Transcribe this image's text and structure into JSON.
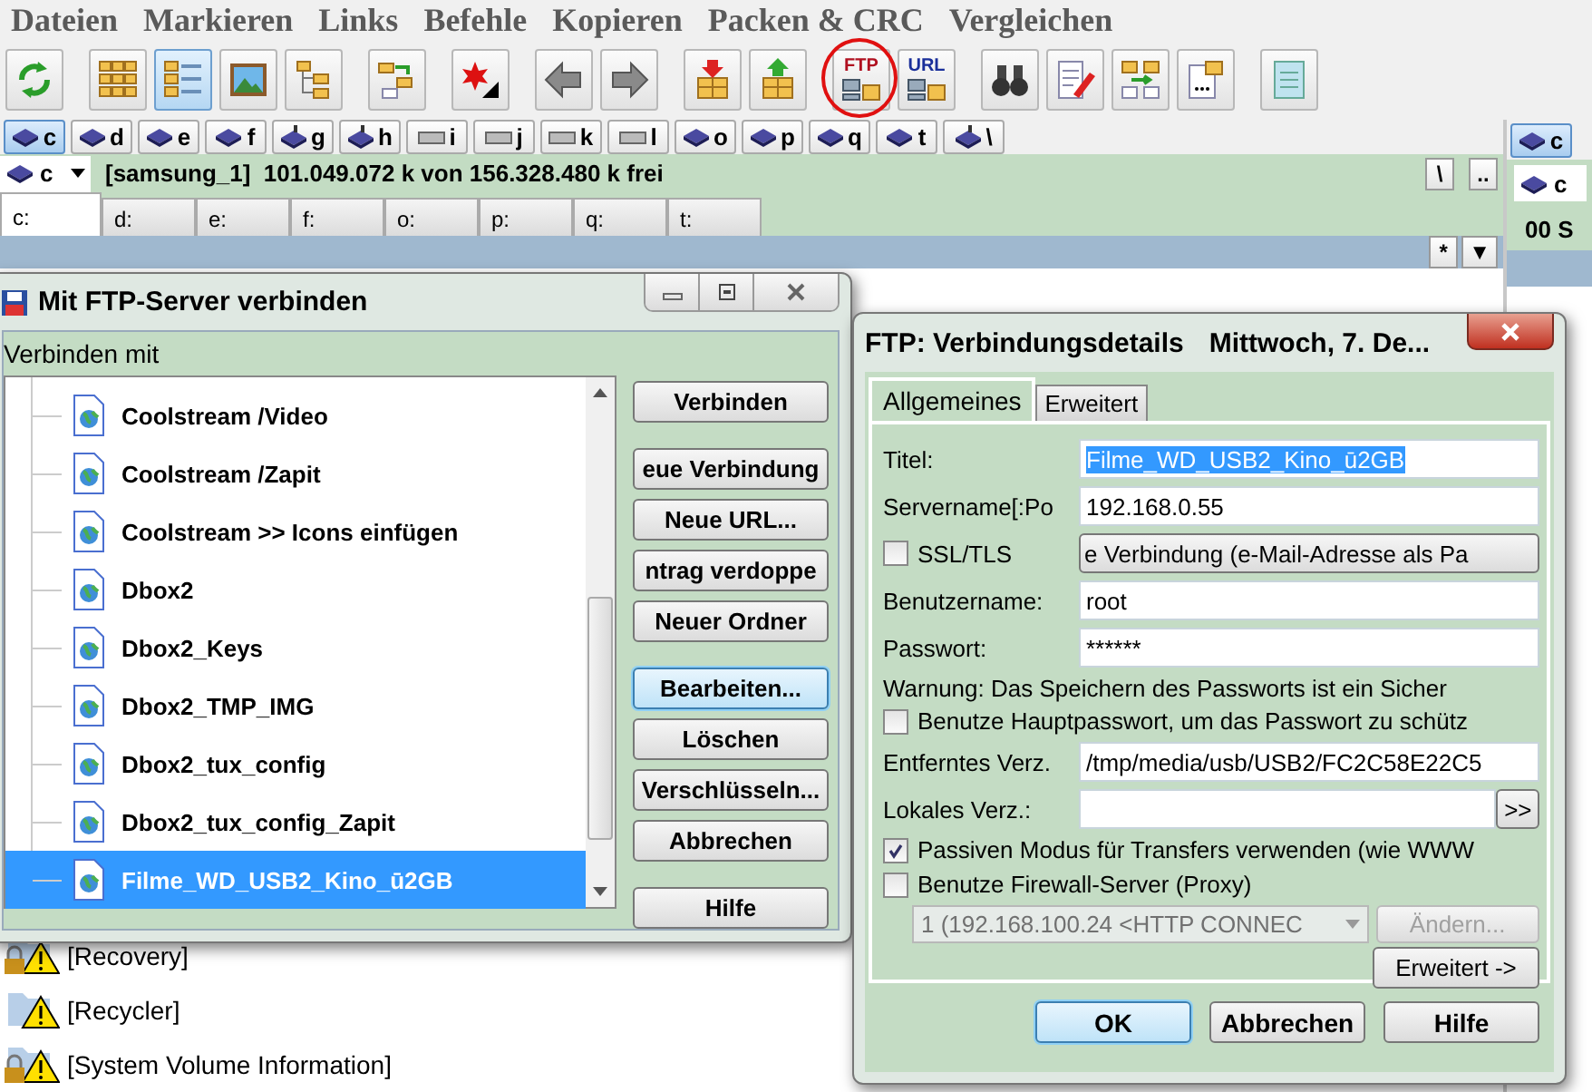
{
  "menu": [
    "Dateien",
    "Markieren",
    "Links",
    "Befehle",
    "Kopieren",
    "Packen & CRC",
    "Vergleichen"
  ],
  "toolbar": [
    {
      "buttons": [
        {
          "kind": "refresh",
          "pressed": false,
          "highlighted": false
        }
      ]
    },
    {
      "buttons": [
        {
          "kind": "grid",
          "pressed": false,
          "highlighted": false
        },
        {
          "kind": "brief",
          "pressed": true,
          "highlighted": false
        },
        {
          "kind": "image",
          "pressed": false,
          "highlighted": false
        },
        {
          "kind": "tree",
          "pressed": false,
          "highlighted": false
        }
      ]
    },
    {
      "buttons": [
        {
          "kind": "syncdir",
          "pressed": false,
          "highlighted": false
        }
      ]
    },
    {
      "buttons": [
        {
          "kind": "star",
          "pressed": false,
          "highlighted": false
        }
      ]
    },
    {
      "buttons": [
        {
          "kind": "back",
          "pressed": false,
          "highlighted": false
        },
        {
          "kind": "forward",
          "pressed": false,
          "highlighted": false
        }
      ]
    },
    {
      "buttons": [
        {
          "kind": "pack",
          "pressed": false,
          "highlighted": false
        },
        {
          "kind": "unpack",
          "pressed": false,
          "highlighted": false
        }
      ]
    },
    {
      "buttons": [
        {
          "kind": "ftp",
          "label": "FTP",
          "pressed": false,
          "highlighted": true
        },
        {
          "kind": "url",
          "label": "URL",
          "pressed": false,
          "highlighted": false
        }
      ]
    },
    {
      "buttons": [
        {
          "kind": "binoculars",
          "pressed": false,
          "highlighted": false
        },
        {
          "kind": "edit",
          "pressed": false,
          "highlighted": false
        },
        {
          "kind": "compare",
          "pressed": false,
          "highlighted": false
        },
        {
          "kind": "copynames",
          "pressed": false,
          "highlighted": false
        }
      ]
    },
    {
      "buttons": [
        {
          "kind": "notepad",
          "pressed": false,
          "highlighted": false
        }
      ]
    }
  ],
  "drives": [
    {
      "letter": "c",
      "kind": "hdd",
      "selected": true
    },
    {
      "letter": "d",
      "kind": "hdd",
      "selected": false
    },
    {
      "letter": "e",
      "kind": "hdd",
      "selected": false
    },
    {
      "letter": "f",
      "kind": "hdd",
      "selected": false
    },
    {
      "letter": "g",
      "kind": "net",
      "selected": false
    },
    {
      "letter": "h",
      "kind": "net",
      "selected": false
    },
    {
      "letter": "i",
      "kind": "removable",
      "selected": false
    },
    {
      "letter": "j",
      "kind": "removable",
      "selected": false
    },
    {
      "letter": "k",
      "kind": "removable",
      "selected": false
    },
    {
      "letter": "l",
      "kind": "removable",
      "selected": false
    },
    {
      "letter": "o",
      "kind": "hdd",
      "selected": false
    },
    {
      "letter": "p",
      "kind": "hdd",
      "selected": false
    },
    {
      "letter": "q",
      "kind": "hdd",
      "selected": false
    },
    {
      "letter": "t",
      "kind": "hdd",
      "selected": false
    },
    {
      "letter": "\\",
      "kind": "net",
      "selected": false
    }
  ],
  "path_bar": {
    "drive": "c",
    "info": "[samsung_1]  101.049.072 k von 156.328.480 k frei",
    "buttons": [
      "\\",
      ".."
    ]
  },
  "drive_tabs": [
    {
      "label": "c:",
      "selected": true
    },
    {
      "label": "d:",
      "selected": false
    },
    {
      "label": "e:",
      "selected": false
    },
    {
      "label": "f:",
      "selected": false
    },
    {
      "label": "o:",
      "selected": false
    },
    {
      "label": "p:",
      "selected": false
    },
    {
      "label": "q:",
      "selected": false
    },
    {
      "label": "t:",
      "selected": false
    }
  ],
  "header_buttons": [
    "*",
    "▼"
  ],
  "file_list": [
    {
      "name": "[Recovery]",
      "locked": true
    },
    {
      "name": "[Recycler]",
      "locked": false
    },
    {
      "name": "[System Volume Information]",
      "locked": true
    }
  ],
  "right_panel": {
    "drive": "c",
    "combo": "c",
    "free": "00 S"
  },
  "ftp_dialog": {
    "title": "Mit FTP-Server verbinden",
    "label": "Verbinden mit",
    "entries": [
      {
        "name": "Coolstream /Video",
        "selected": false
      },
      {
        "name": "Coolstream /Zapit",
        "selected": false
      },
      {
        "name": "Coolstream >> Icons einfügen",
        "selected": false
      },
      {
        "name": "Dbox2",
        "selected": false
      },
      {
        "name": "Dbox2_Keys",
        "selected": false
      },
      {
        "name": "Dbox2_TMP_IMG",
        "selected": false
      },
      {
        "name": "Dbox2_tux_config",
        "selected": false
      },
      {
        "name": "Dbox2_tux_config_Zapit",
        "selected": false
      },
      {
        "name": "Filme_WD_USB2_Kino_ū2GB",
        "selected": true
      }
    ],
    "button_groups": [
      {
        "buttons": [
          {
            "label": "Verbinden",
            "focused": false
          }
        ]
      },
      {
        "buttons": [
          {
            "label": "eue Verbindung",
            "focused": false
          },
          {
            "label": "Neue URL...",
            "focused": false
          },
          {
            "label": "ntrag verdoppe",
            "focused": false
          },
          {
            "label": "Neuer Ordner",
            "focused": false
          }
        ]
      },
      {
        "buttons": [
          {
            "label": "Bearbeiten...",
            "focused": true
          },
          {
            "label": "Löschen",
            "focused": false
          },
          {
            "label": "Verschlüsseln...",
            "focused": false
          },
          {
            "label": "Abbrechen",
            "focused": false
          }
        ]
      },
      {
        "buttons": [
          {
            "label": "Hilfe",
            "focused": false
          }
        ]
      }
    ]
  },
  "details_dialog": {
    "title": "FTP: Verbindungsdetails",
    "subtitle": "Mittwoch, 7. De...",
    "tabs": [
      {
        "label": "Allgemeines",
        "selected": true
      },
      {
        "label": "Erweitert",
        "selected": false
      }
    ],
    "rows": [
      {
        "kind": "field",
        "label": "Titel:",
        "value": "Filme_WD_USB2_Kino_ū2GB",
        "highlighted": true
      },
      {
        "kind": "field",
        "label": "Servername[:Po",
        "value": "192.168.0.55",
        "highlighted": false
      },
      {
        "kind": "check_button",
        "label": "SSL/TLS",
        "checked": false,
        "button": "e Verbindung (e-Mail-Adresse als Pa"
      },
      {
        "kind": "field",
        "label": "Benutzername:",
        "value": "root",
        "highlighted": false
      },
      {
        "kind": "field",
        "label": "Passwort:",
        "value": "******",
        "highlighted": false
      },
      {
        "kind": "note",
        "label": "Warnung: Das Speichern des Passworts ist ein Sicher"
      },
      {
        "kind": "checkbox",
        "label": "Benutze Hauptpasswort, um das Passwort zu schütz",
        "checked": false
      },
      {
        "kind": "field",
        "label": "Entferntes Verz.",
        "value": "/tmp/media/usb/USB2/FC2C58E22C5",
        "highlighted": false
      },
      {
        "kind": "browse",
        "label": "Lokales Verz.:",
        "button": ">>"
      },
      {
        "kind": "checkbox",
        "label": "Passiven Modus für Transfers verwenden (wie WWW",
        "checked": true
      },
      {
        "kind": "checkbox",
        "label": "Benutze Firewall-Server (Proxy)",
        "checked": false
      },
      {
        "kind": "proxy",
        "value": "1 (192.168.100.24 <HTTP CONNEC",
        "button": "Ändern...",
        "disabled": true
      },
      {
        "kind": "more",
        "button": "Erweitert ->"
      }
    ],
    "buttons": [
      {
        "label": "OK",
        "default": true
      },
      {
        "label": "Abbrechen",
        "default": false
      },
      {
        "label": "Hilfe",
        "default": false
      }
    ]
  }
}
